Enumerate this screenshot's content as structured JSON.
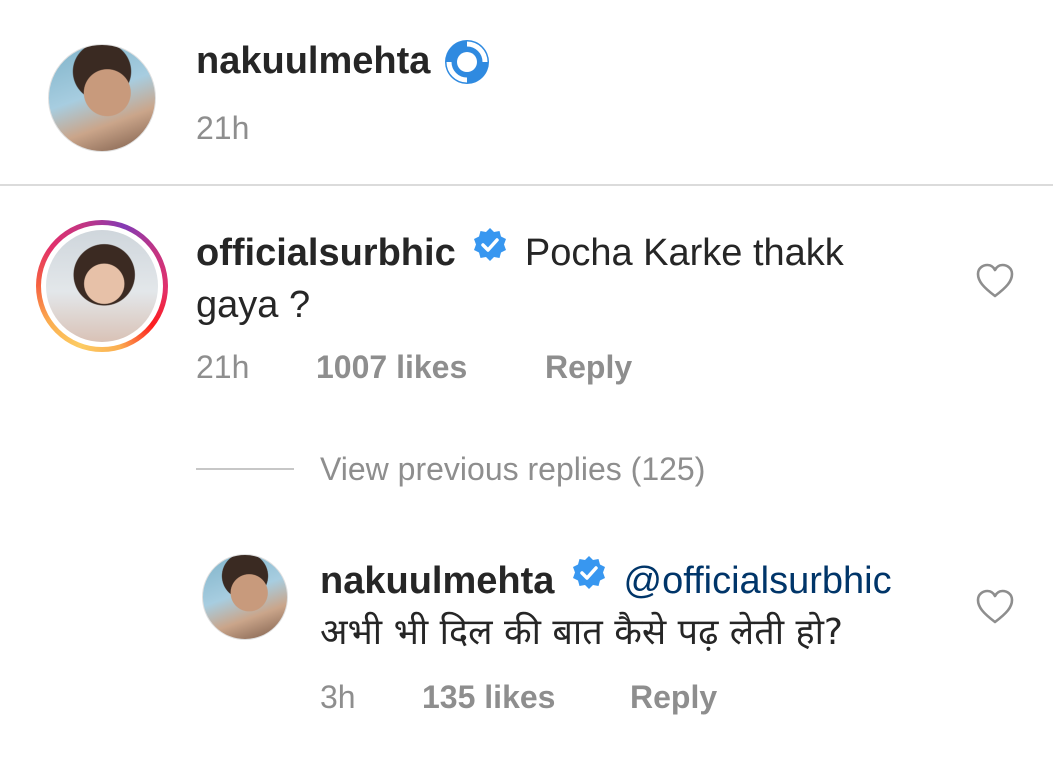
{
  "post_header": {
    "username": "nakuulmehta",
    "time": "21h"
  },
  "comment": {
    "username": "officialsurbhic",
    "text_line1": "Pocha Karke thakk",
    "text_line2": "gaya ?",
    "time": "21h",
    "likes": "1007 likes",
    "reply_label": "Reply"
  },
  "view_replies": {
    "label": "View previous replies (125)"
  },
  "reply": {
    "username": "nakuulmehta",
    "mention": "@officialsurbhic",
    "text": "अभी भी दिल की बात कैसे पढ़ लेती हो?",
    "time": "3h",
    "likes": "135 likes",
    "reply_label": "Reply"
  },
  "colors": {
    "verified_blue": "#3897f0",
    "mention": "#003569",
    "meta_gray": "#8e8e8e"
  },
  "icons": {
    "verified": "verified-badge-icon",
    "heart": "heart-outline-icon"
  }
}
